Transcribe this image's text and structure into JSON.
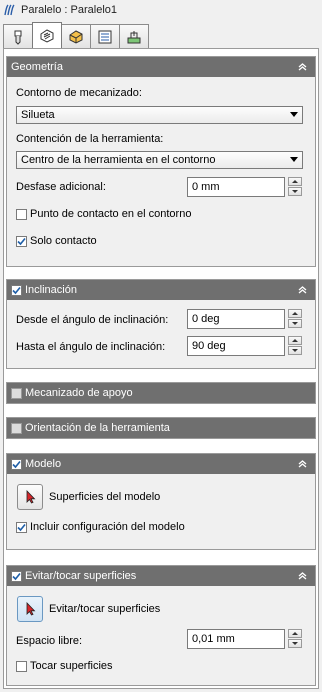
{
  "window": {
    "title": "Paralelo : Paralelo1"
  },
  "tabs": [
    {
      "icon": "tool-icon"
    },
    {
      "icon": "geometry-icon",
      "active": true
    },
    {
      "icon": "passes-icon"
    },
    {
      "icon": "linking-icon"
    },
    {
      "icon": "entry-exit-icon"
    }
  ],
  "geometria": {
    "header": "Geometría",
    "contorno_label": "Contorno de mecanizado:",
    "contorno_value": "Silueta",
    "contencion_label": "Contención de la herramienta:",
    "contencion_value": "Centro de la herramienta en el contorno",
    "desfase_label": "Desfase adicional:",
    "desfase_value": "0 mm",
    "punto_contacto_label": "Punto de contacto en el contorno",
    "punto_contacto_checked": false,
    "solo_contacto_label": "Solo contacto",
    "solo_contacto_checked": true
  },
  "inclinacion": {
    "header": "Inclinación",
    "checked": true,
    "desde_label": "Desde el ángulo de inclinación:",
    "desde_value": "0 deg",
    "hasta_label": "Hasta el ángulo de inclinación:",
    "hasta_value": "90 deg"
  },
  "mecanizado_apoyo": {
    "header": "Mecanizado de apoyo",
    "checked": false
  },
  "orientacion": {
    "header": "Orientación de la herramienta",
    "checked": false
  },
  "modelo": {
    "header": "Modelo",
    "checked": true,
    "superficies_label": "Superficies del modelo",
    "incluir_label": "Incluir configuración del modelo",
    "incluir_checked": true
  },
  "evitar": {
    "header": "Evitar/tocar superficies",
    "checked": true,
    "button_label": "Evitar/tocar superficies",
    "espacio_label": "Espacio libre:",
    "espacio_value": "0,01 mm",
    "tocar_label": "Tocar superficies",
    "tocar_checked": false
  },
  "colors": {
    "header_bg": "#6f6f6f",
    "panel_bg": "#f0f0f0",
    "check_blue": "#1f5fa8"
  }
}
